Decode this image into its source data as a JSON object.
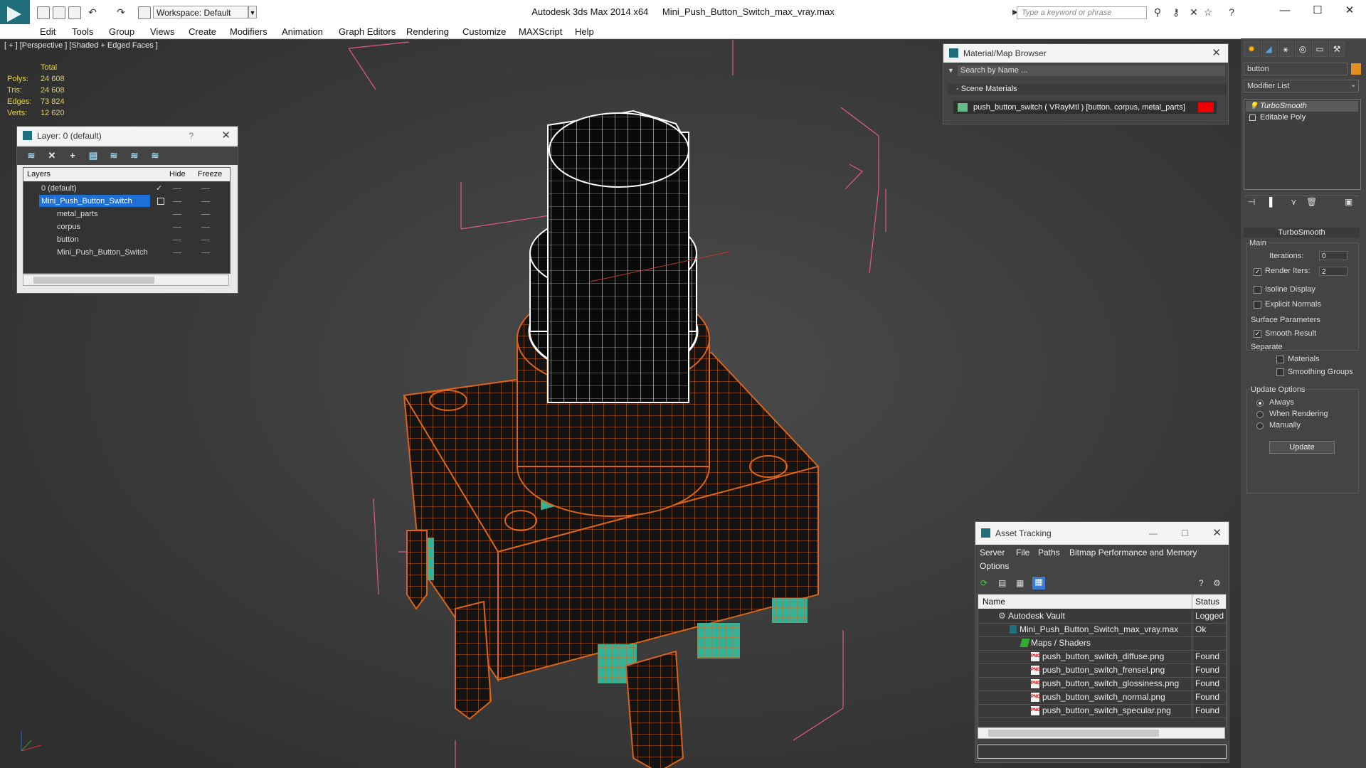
{
  "title_bar": {
    "app": "Autodesk 3ds Max  2014 x64",
    "file": "Mini_Push_Button_Switch_max_vray.max",
    "workspace": "Workspace: Default",
    "search_placeholder": "Type a keyword or phrase"
  },
  "menu": [
    "Edit",
    "Tools",
    "Group",
    "Views",
    "Create",
    "Modifiers",
    "Animation",
    "Graph Editors",
    "Rendering",
    "Customize",
    "MAXScript",
    "Help"
  ],
  "viewport": {
    "label": "[ + ] [Perspective ] [Shaded + Edged Faces ]",
    "stats": {
      "header": "Total",
      "rows": [
        {
          "label": "Polys:",
          "value": "24 608"
        },
        {
          "label": "Tris:",
          "value": "24 608"
        },
        {
          "label": "Edges:",
          "value": "73 824"
        },
        {
          "label": "Verts:",
          "value": "12 620"
        }
      ]
    }
  },
  "layer_window": {
    "title": "Layer: 0 (default)",
    "help": "?",
    "columns": {
      "layers": "Layers",
      "hide": "Hide",
      "freeze": "Freeze"
    },
    "rows": [
      {
        "name": "0 (default)",
        "selected": false,
        "indent": 1
      },
      {
        "name": "Mini_Push_Button_Switch",
        "selected": true,
        "indent": 1
      },
      {
        "name": "metal_parts",
        "selected": false,
        "indent": 2
      },
      {
        "name": "corpus",
        "selected": false,
        "indent": 2
      },
      {
        "name": "button",
        "selected": false,
        "indent": 2
      },
      {
        "name": "Mini_Push_Button_Switch",
        "selected": false,
        "indent": 2
      }
    ]
  },
  "material_browser": {
    "title": "Material/Map Browser",
    "search": "Search by Name ...",
    "section": "- Scene Materials",
    "material": "push_button_switch  ( VRayMtl ) [button, corpus, metal_parts]",
    "swatch_color": "#e00000"
  },
  "command_panel": {
    "object_name": "button",
    "modifier_list": "Modifier List",
    "stack": [
      "TurboSmooth",
      "Editable Poly"
    ],
    "turbosmooth": {
      "title": "TurboSmooth",
      "main": "Main",
      "iterations_label": "Iterations:",
      "iterations": "0",
      "render_iters_label": "Render Iters:",
      "render_iters": "2",
      "render_iters_checked": true,
      "isoline": "Isoline Display",
      "explicit": "Explicit Normals",
      "surface": "Surface Parameters",
      "smooth_result": "Smooth Result",
      "separate": "Separate",
      "materials": "Materials",
      "smoothing_groups": "Smoothing Groups",
      "update_options": "Update Options",
      "always": "Always",
      "when_rendering": "When Rendering",
      "manually": "Manually",
      "update_button": "Update"
    }
  },
  "asset_tracking": {
    "title": "Asset Tracking",
    "menu": [
      "Server",
      "File",
      "Paths",
      "Bitmap Performance and Memory",
      "Options"
    ],
    "columns": {
      "name": "Name",
      "status": "Status"
    },
    "rows": [
      {
        "name": "Autodesk Vault",
        "status": "Logged",
        "indent": 0
      },
      {
        "name": "Mini_Push_Button_Switch_max_vray.max",
        "status": "Ok",
        "indent": 1
      },
      {
        "name": "Maps / Shaders",
        "status": "",
        "indent": 2
      },
      {
        "name": "push_button_switch_diffuse.png",
        "status": "Found",
        "indent": 3
      },
      {
        "name": "push_button_switch_frensel.png",
        "status": "Found",
        "indent": 3
      },
      {
        "name": "push_button_switch_glossiness.png",
        "status": "Found",
        "indent": 3
      },
      {
        "name": "push_button_switch_normal.png",
        "status": "Found",
        "indent": 3
      },
      {
        "name": "push_button_switch_specular.png",
        "status": "Found",
        "indent": 3
      }
    ],
    "file_tag": "PNG"
  },
  "colors": {
    "wire_orange": "#d9641a",
    "body_dark": "#141414",
    "teal": "#2fb39a",
    "bbox_pink": "#e05a8c",
    "selection_blue": "#1e6fd6"
  }
}
